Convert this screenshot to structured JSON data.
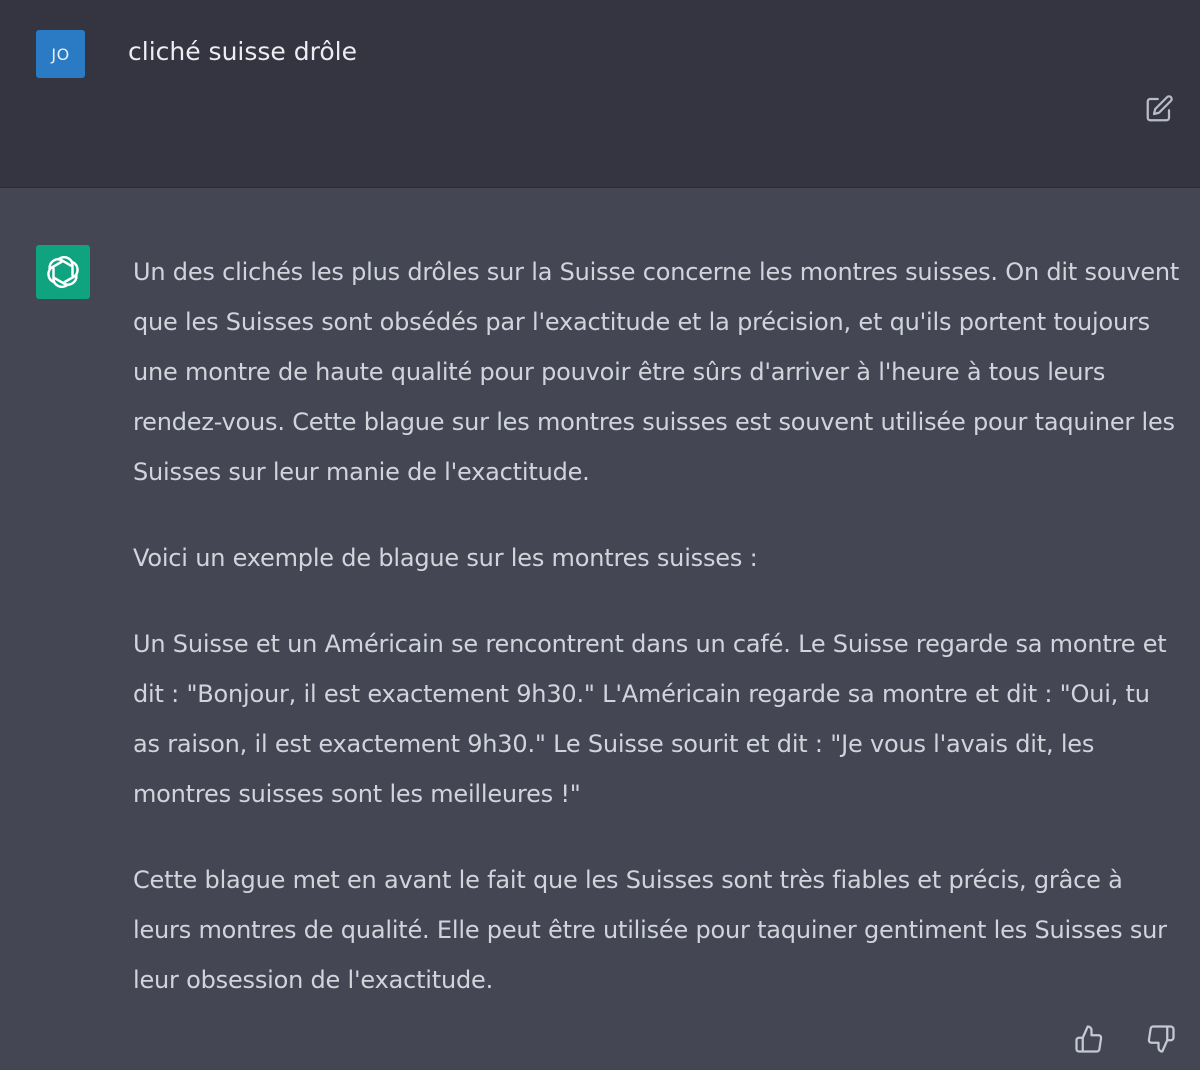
{
  "user_message": {
    "avatar_initials": "JO",
    "text": "cliché suisse drôle",
    "avatar_color": "#2b7bc4"
  },
  "assistant_message": {
    "avatar_icon": "openai-logo-icon",
    "avatar_color": "#10a37f",
    "paragraphs": [
      "Un des clichés les plus drôles sur la Suisse concerne les montres suisses. On dit souvent que les Suisses sont obsédés par l'exactitude et la précision, et qu'ils portent toujours une montre de haute qualité pour pouvoir être sûrs d'arriver à l'heure à tous leurs rendez-vous. Cette blague sur les montres suisses est souvent utilisée pour taquiner les Suisses sur leur manie de l'exactitude.",
      "Voici un exemple de blague sur les montres suisses :",
      "Un Suisse et un Américain se rencontrent dans un café. Le Suisse regarde sa montre et dit : \"Bonjour, il est exactement 9h30.\" L'Américain regarde sa montre et dit : \"Oui, tu as raison, il est exactement 9h30.\" Le Suisse sourit et dit : \"Je vous l'avais dit, les montres suisses sont les meilleures !\"",
      "Cette blague met en avant le fait que les Suisses sont très fiables et précis, grâce à leurs montres de qualité. Elle peut être utilisée pour taquiner gentiment les Suisses sur leur obsession de l'exactitude."
    ]
  },
  "icons": {
    "edit": "edit-icon",
    "thumbs_up": "thumbs-up-icon",
    "thumbs_down": "thumbs-down-icon"
  },
  "colors": {
    "user_background": "#343541",
    "assistant_background": "#444654",
    "text": "#d1d5db"
  }
}
